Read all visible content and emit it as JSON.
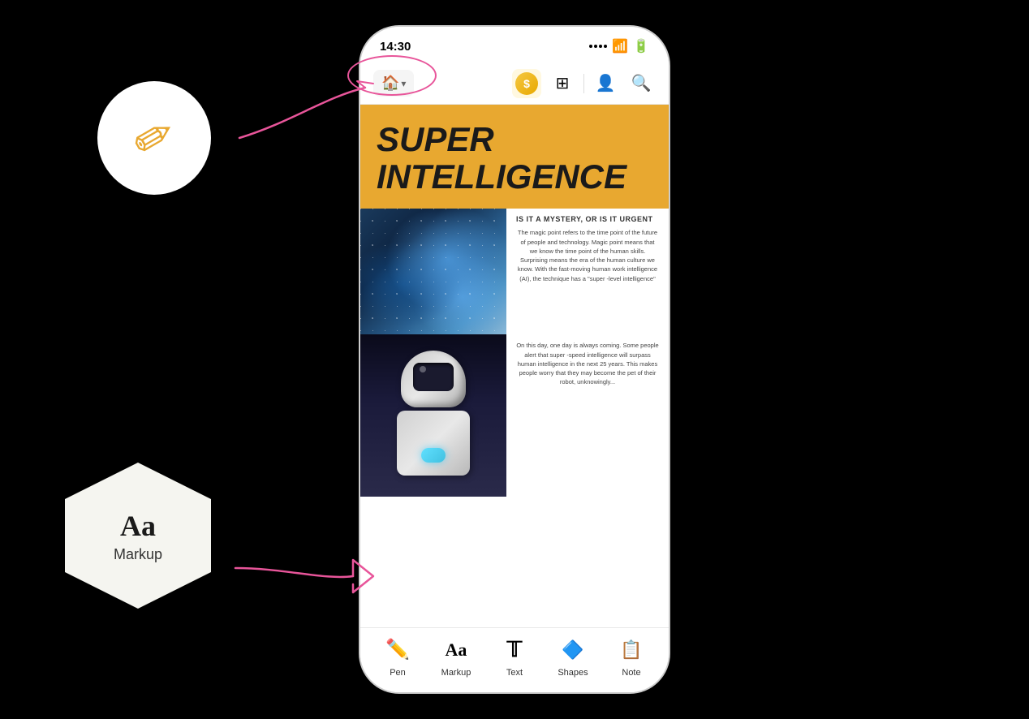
{
  "status_bar": {
    "time": "14:30",
    "wifi": "wifi",
    "battery": "charging"
  },
  "nav": {
    "home_icon": "🏠",
    "chevron": "▾",
    "coin_icon": "$",
    "translate_icon": "⊞",
    "user_icon": "👤",
    "search_icon": "🔍"
  },
  "article": {
    "title_line1": "SUPER",
    "title_line2": "INTELLIGENCE",
    "subtitle": "IS IT A MYSTERY, OR IS IT URGENT",
    "body_text_1": "The magic point refers to the time point of the future of people and technology. Magic point means that we know the time point of the human skills. Surprising means the era of the human culture we know. With the fast-moving human work intelligence (AI), the technique has a \"super -level intelligence\"",
    "body_text_2": "On this day, one day is always coming. Some people alert that super -speed intelligence will surpass human intelligence in the next 25 years. This makes people worry that they may become the pet of their robot, unknowingly..."
  },
  "toolbar": {
    "items": [
      {
        "id": "pen",
        "label": "Pen",
        "icon": "✏️"
      },
      {
        "id": "markup",
        "label": "Markup",
        "icon": "Aa"
      },
      {
        "id": "text",
        "label": "Text",
        "icon": "T"
      },
      {
        "id": "shapes",
        "label": "Shapes",
        "icon": "★"
      },
      {
        "id": "note",
        "label": "Note",
        "icon": "📝"
      }
    ]
  },
  "floating": {
    "pen_circle_title": "Pen tool circle",
    "markup_hex_label": "Markup"
  }
}
